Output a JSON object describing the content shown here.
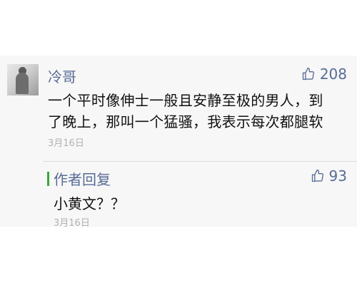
{
  "comment": {
    "username": "冷哥",
    "likes": "208",
    "text_line1": "一个平时像伸士一般且安静至极的男人，到",
    "text_line2": "了晚上，那叫一个猛骚，我表示每次都腿软",
    "date": "3月16日"
  },
  "reply": {
    "title": "作者回复",
    "likes": "93",
    "text": "小黄文？？",
    "date": "3月16日",
    "accent_color": "#3aa835"
  },
  "colors": {
    "link": "#576b95",
    "text": "#111111",
    "muted": "#b2b2b2",
    "panel": "#f7f7f7"
  },
  "icons": {
    "like": "thumbs-up-icon"
  }
}
